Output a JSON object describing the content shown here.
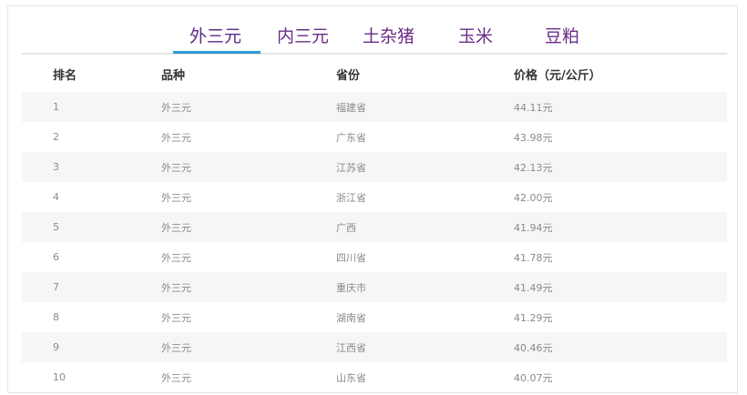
{
  "tabs": [
    {
      "label": "外三元",
      "active": true
    },
    {
      "label": "内三元",
      "active": false
    },
    {
      "label": "土杂猪",
      "active": false
    },
    {
      "label": "玉米",
      "active": false
    },
    {
      "label": "豆粕",
      "active": false
    }
  ],
  "table": {
    "headers": [
      "排名",
      "品种",
      "省份",
      "价格（元/公斤）"
    ],
    "rows": [
      {
        "rank": "1",
        "breed": "外三元",
        "province": "福建省",
        "price": "44.11元"
      },
      {
        "rank": "2",
        "breed": "外三元",
        "province": "广东省",
        "price": "43.98元"
      },
      {
        "rank": "3",
        "breed": "外三元",
        "province": "江苏省",
        "price": "42.13元"
      },
      {
        "rank": "4",
        "breed": "外三元",
        "province": "浙江省",
        "price": "42.00元"
      },
      {
        "rank": "5",
        "breed": "外三元",
        "province": "广西",
        "price": "41.94元"
      },
      {
        "rank": "6",
        "breed": "外三元",
        "province": "四川省",
        "price": "41.78元"
      },
      {
        "rank": "7",
        "breed": "外三元",
        "province": "重庆市",
        "price": "41.49元"
      },
      {
        "rank": "8",
        "breed": "外三元",
        "province": "湖南省",
        "price": "41.29元"
      },
      {
        "rank": "9",
        "breed": "外三元",
        "province": "江西省",
        "price": "40.46元"
      },
      {
        "rank": "10",
        "breed": "外三元",
        "province": "山东省",
        "price": "40.07元"
      }
    ]
  },
  "colors": {
    "tab_text": "#6a2b86",
    "tab_active_underline": "#2f9bd8",
    "row_stripe": "#f6f6f8",
    "header_text": "#333333",
    "cell_text": "#8a8a8a"
  }
}
